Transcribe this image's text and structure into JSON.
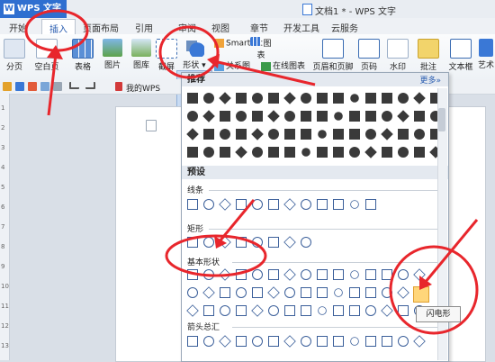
{
  "titlebar": {
    "app_button": "WPS 文字",
    "window_title": "文档1 * - WPS 文字"
  },
  "menu_tabs": [
    "开始",
    "插入",
    "页面布局",
    "引用",
    "审阅",
    "视图",
    "章节",
    "开发工具",
    "云服务"
  ],
  "ribbon": {
    "buttons": [
      "分页",
      "空白页",
      "表格",
      "图片",
      "图库",
      "截屏",
      "形状",
      "图表",
      "页眉和页脚",
      "页码",
      "水印",
      "批注",
      "文本框",
      "艺术"
    ],
    "small": [
      "SmartArt",
      "关系图",
      "在线图表"
    ]
  },
  "quickbar": {
    "my_wps": "我的WPS"
  },
  "panel": {
    "recommended": "推荐",
    "more": "更多»",
    "preset": "预设",
    "lines": "线条",
    "rectangles": "矩形",
    "basic_shapes": "基本形状",
    "block_arrows": "箭头总汇",
    "tooltip": "闪电形"
  },
  "ruler_numbers": [
    "1",
    "2",
    "3",
    "4",
    "5",
    "6",
    "7",
    "8",
    "9",
    "10",
    "11",
    "12",
    "13"
  ],
  "colors": {
    "accent": "#2f6fd0",
    "annotation": "#e8262c",
    "panel_header": "#e4e9f0"
  }
}
